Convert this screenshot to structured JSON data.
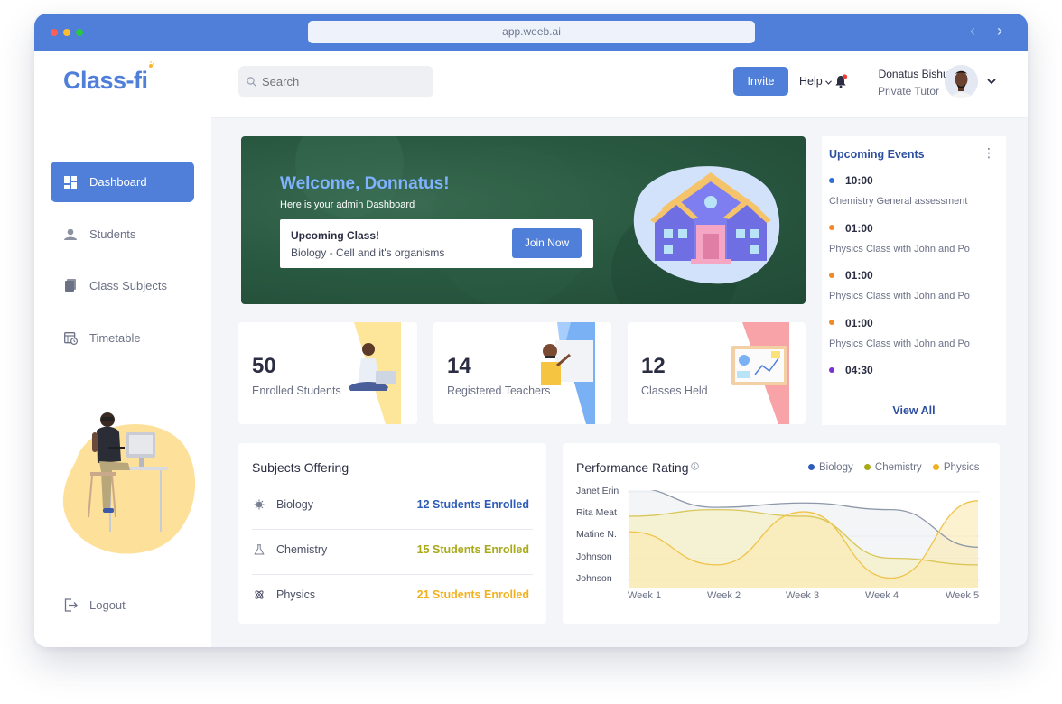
{
  "browser": {
    "url": "app.weeb.ai",
    "dots": [
      "#ff5f57",
      "#febc2e",
      "#28c840"
    ]
  },
  "brand": {
    "logo": "Class-fi"
  },
  "sidebar": {
    "items": [
      {
        "label": "Dashboard",
        "icon": "dashboard-icon",
        "active": true
      },
      {
        "label": "Students",
        "icon": "user-icon",
        "active": false
      },
      {
        "label": "Class Subjects",
        "icon": "book-icon",
        "active": false
      },
      {
        "label": "Timetable",
        "icon": "calendar-icon",
        "active": false
      }
    ],
    "logout": "Logout"
  },
  "topbar": {
    "search_placeholder": "Search",
    "invite_label": "Invite",
    "help_label": "Help",
    "user_name": "Donatus Bishung",
    "user_role": "Private Tutor"
  },
  "hero": {
    "title": "Welcome, Donnatus!",
    "subtitle": "Here is your admin Dashboard",
    "upcoming_title": "Upcoming Class!",
    "upcoming_subject": "Biology - Cell and it's organisms",
    "join_label": "Join Now"
  },
  "stats": [
    {
      "value": "50",
      "label": "Enrolled Students"
    },
    {
      "value": "14",
      "label": "Registered Teachers"
    },
    {
      "value": "12",
      "label": "Classes Held"
    }
  ],
  "events": {
    "title": "Upcoming Events",
    "items": [
      {
        "time": "10:00",
        "desc": "Chemistry General assessment",
        "color": "#2f6fd6"
      },
      {
        "time": "01:00",
        "desc": "Physics Class with John and Po",
        "color": "#f08a2a"
      },
      {
        "time": "01:00",
        "desc": "Physics Class with John and Po",
        "color": "#f08a2a"
      },
      {
        "time": "01:00",
        "desc": "Physics Class with John and Po",
        "color": "#f08a2a"
      },
      {
        "time": "04:30",
        "desc": "",
        "color": "#7b2fd6"
      }
    ],
    "view_all": "View All"
  },
  "subjects": {
    "title": "Subjects Offering",
    "rows": [
      {
        "name": "Biology",
        "count": "12 Students Enrolled",
        "color": "#2e5cb8",
        "icon": "virus-icon"
      },
      {
        "name": "Chemistry",
        "count": "15 Students Enrolled",
        "color": "#a9a91a",
        "icon": "flask-icon"
      },
      {
        "name": "Physics",
        "count": "21 Students Enrolled",
        "color": "#f2b01e",
        "icon": "atom-icon"
      }
    ]
  },
  "performance": {
    "title": "Performance Rating",
    "legend": [
      {
        "name": "Biology",
        "color": "#2e5cb8"
      },
      {
        "name": "Chemistry",
        "color": "#a9a91a"
      },
      {
        "name": "Physics",
        "color": "#f2b01e"
      }
    ]
  },
  "chart_data": {
    "type": "area",
    "title": "Performance Rating",
    "categories": [
      "Week 1",
      "Week 2",
      "Week 3",
      "Week 4",
      "Week 5"
    ],
    "y_categories": [
      "Janet Erin",
      "Rita Meat",
      "Matine N.",
      "Johnson",
      "Johnson"
    ],
    "series": [
      {
        "name": "Biology",
        "values": [
          4.2,
          3.3,
          3.5,
          3.2,
          1.5
        ]
      },
      {
        "name": "Chemistry",
        "values": [
          2.9,
          3.2,
          2.9,
          1.0,
          0.7
        ]
      },
      {
        "name": "Physics",
        "values": [
          2.2,
          0.7,
          3.1,
          0.1,
          3.6
        ]
      }
    ],
    "grid": true,
    "legend_position": "top-right"
  }
}
